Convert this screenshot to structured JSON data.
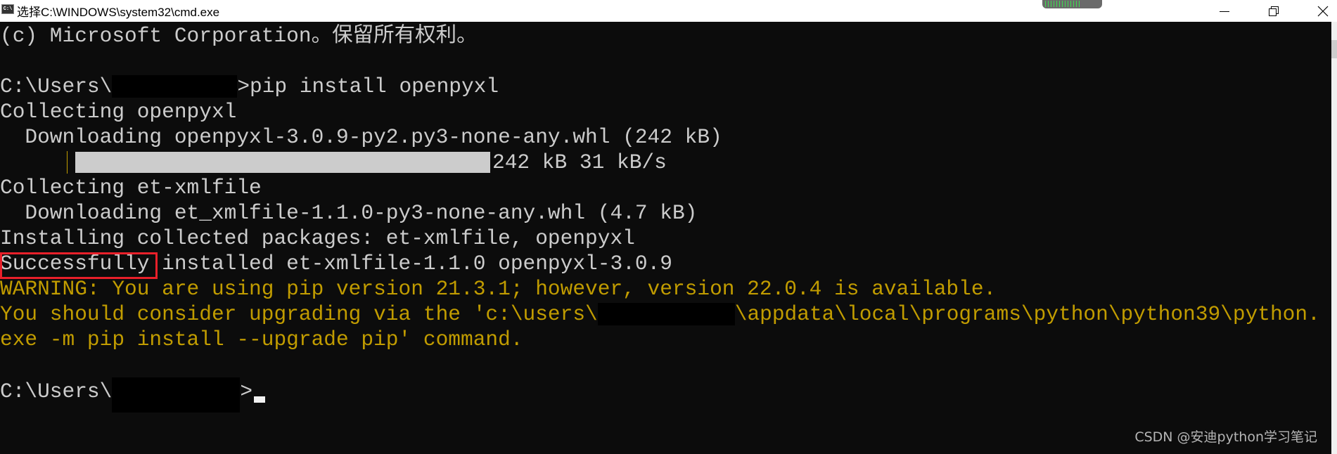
{
  "window": {
    "title": "选择C:\\WINDOWS\\system32\\cmd.exe",
    "icon": "cmd-icon",
    "icon_text": "C:\\",
    "meter_level": 0.6,
    "buttons": [
      "minimize",
      "restore",
      "close"
    ]
  },
  "terminal": {
    "colors": {
      "text": "#cccccc",
      "warning": "#c19c00",
      "background": "#0c0c0c",
      "highlight": "#e8202a"
    },
    "line0": "(c) Microsoft Corporation。保留所有权利。",
    "prompt1_prefix": "C:\\Users\\",
    "prompt1_cmd": ">pip install openpyxl",
    "line3": "Collecting openpyxl",
    "line4": "  Downloading openpyxl-3.0.9-py2.py3-none-any.whl (242 kB)",
    "progress": {
      "percent": 100,
      "text": "242 kB 31 kB/s"
    },
    "line6": "Collecting et-xmlfile",
    "line7": "  Downloading et_xmlfile-1.1.0-py3-none-any.whl (4.7 kB)",
    "line8": "Installing collected packages: et-xmlfile, openpyxl",
    "line9_highlight": "Successfully",
    "line9_rest": " installed et-xmlfile-1.1.0 openpyxl-3.0.9",
    "warning": "WARNING: You are using pip version 21.3.1; however, version 22.0.4 is available.",
    "upgrade_prefix": "You should consider upgrading via the 'c:\\users\\",
    "upgrade_suffix": "\\appdata\\local\\programs\\python\\python39\\python.",
    "upgrade_line2": "exe -m pip install --upgrade pip' command.",
    "prompt2_prefix": "C:\\Users\\",
    "prompt2_suffix": ">"
  },
  "watermark": "CSDN @安迪python学习笔记"
}
